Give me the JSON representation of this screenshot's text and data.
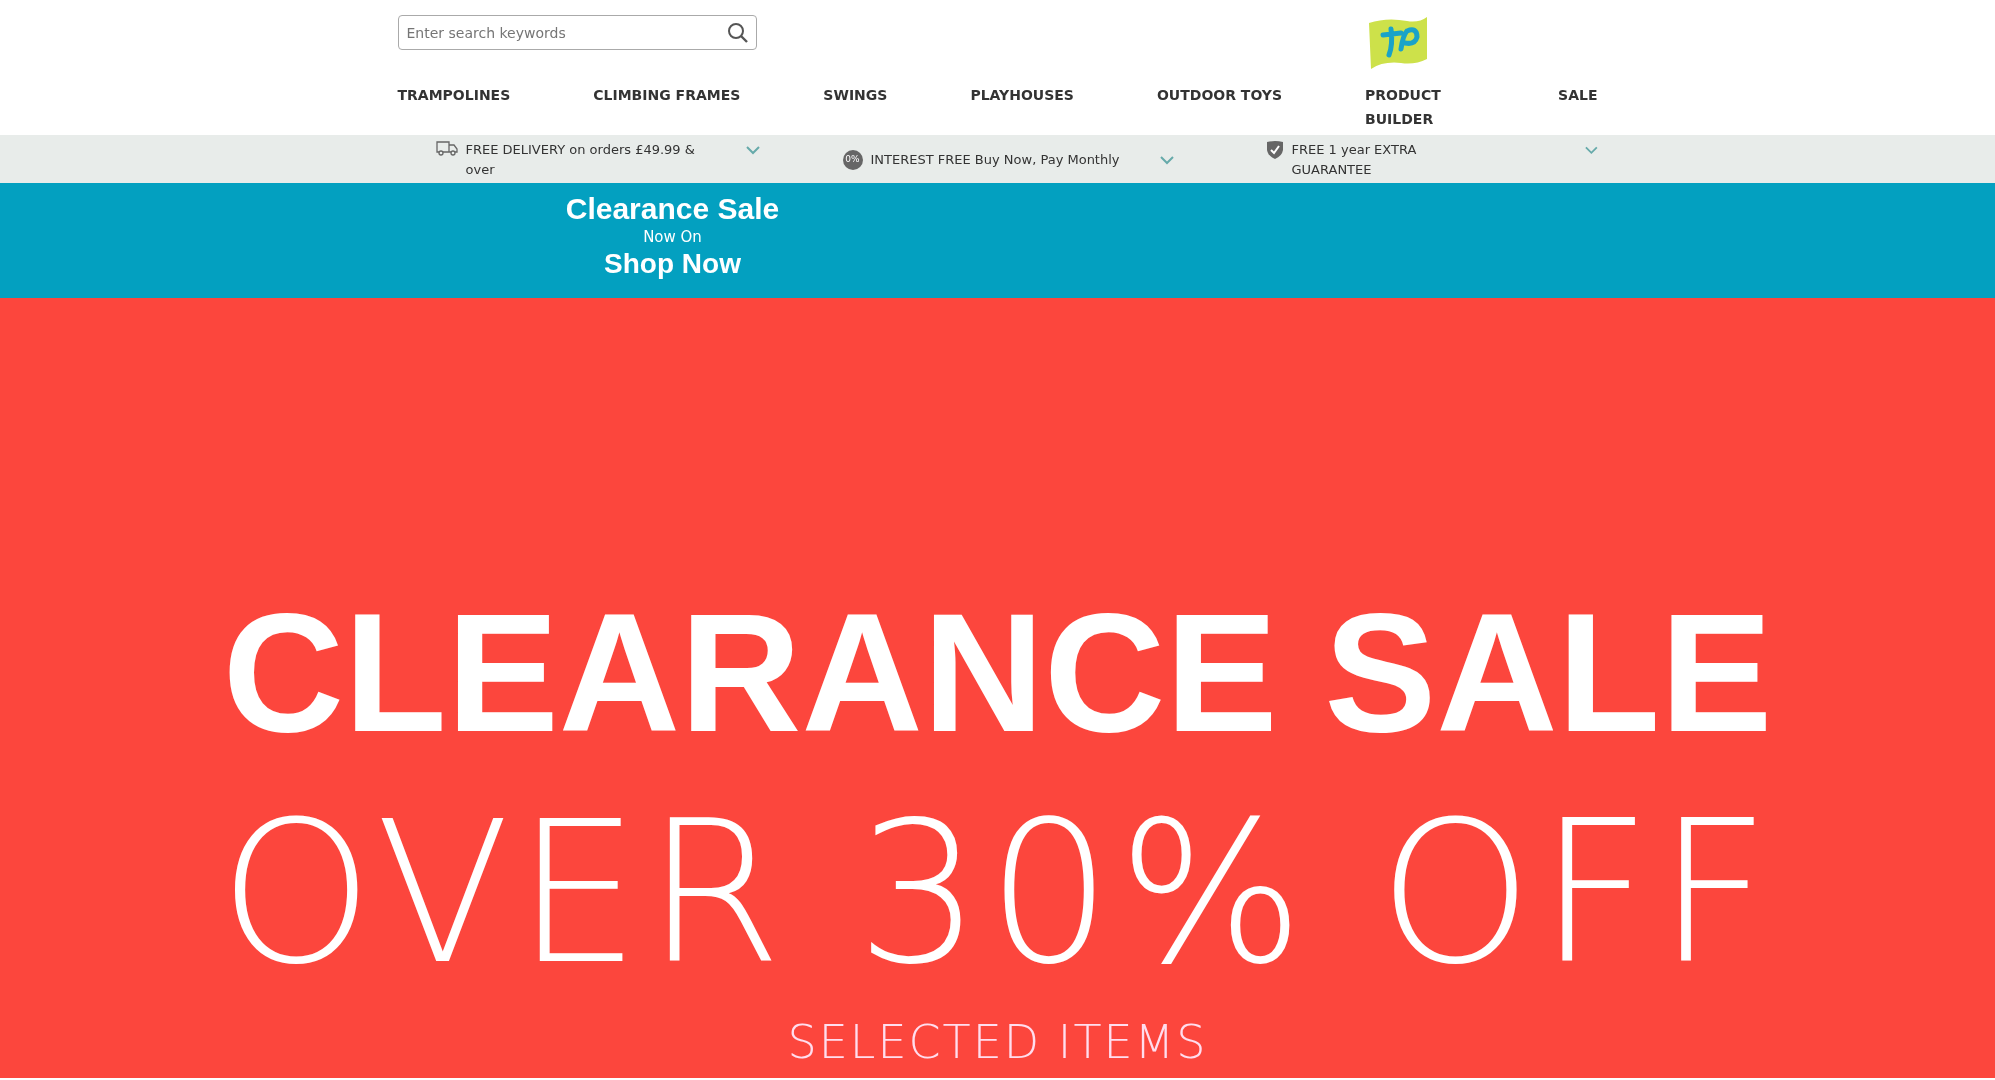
{
  "search": {
    "placeholder": "Enter search keywords"
  },
  "nav": [
    {
      "label": "TRAMPOLINES"
    },
    {
      "label": "CLIMBING FRAMES"
    },
    {
      "label": "SWINGS"
    },
    {
      "label": "PLAYHOUSES"
    },
    {
      "label": "OUTDOOR TOYS"
    },
    {
      "label": "PRODUCT BUILDER"
    },
    {
      "label": "SALE"
    }
  ],
  "usps": [
    {
      "kind": "truck",
      "text": "FREE DELIVERY on orders £49.99 & over"
    },
    {
      "kind": "percent",
      "icon_text": "0%",
      "text": "INTEREST FREE Buy Now, Pay Monthly"
    },
    {
      "kind": "shield",
      "text": "FREE 1 year EXTRA GUARANTEE"
    }
  ],
  "promo": {
    "title": "Clearance Sale",
    "subtitle": "Now On",
    "link": "Shop Now"
  },
  "hero": {
    "headline": "CLEARANCE SALE",
    "offer": "OVER 30% OFF",
    "note": "SELECTED ITEMS"
  }
}
